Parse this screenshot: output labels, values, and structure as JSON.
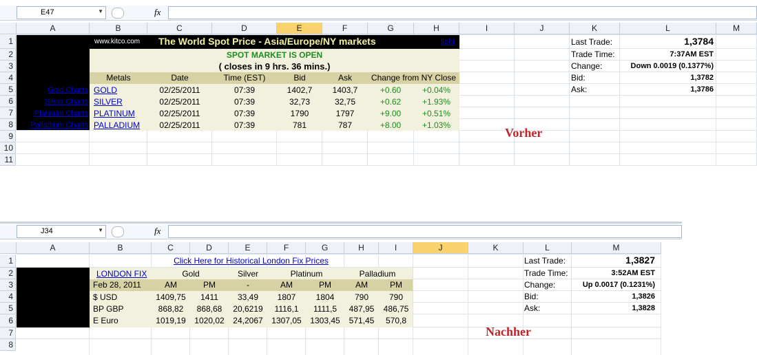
{
  "top": {
    "name_box": "E47",
    "fx_label": "fx",
    "columns": [
      "A",
      "B",
      "C",
      "D",
      "E",
      "F",
      "G",
      "H",
      "I",
      "J",
      "K",
      "L",
      "M"
    ],
    "rows": [
      "1",
      "2",
      "3",
      "4",
      "5",
      "6",
      "7",
      "8",
      "9",
      "10",
      "11"
    ],
    "kitco": "www.kitco.com",
    "title": "The World Spot Price - Asia/Europe/NY markets",
    "light": "light",
    "market_status": "SPOT MARKET IS OPEN",
    "closes_in": "( closes in 9 hrs. 36 mins.)",
    "headers": [
      "Metals",
      "Date",
      "Time (EST)",
      "Bid",
      "Ask",
      "Change from NY Close"
    ],
    "chart_links": [
      "Gold Charts",
      "Silver Charts",
      "Platinum Charts",
      "Palladium Charts"
    ],
    "metals": [
      {
        "name": "GOLD",
        "date": "02/25/2011",
        "time": "07:39",
        "bid": "1402,7",
        "ask": "1403,7",
        "chg": "+0.60",
        "pct": "+0.04%"
      },
      {
        "name": "SILVER",
        "date": "02/25/2011",
        "time": "07:39",
        "bid": "32,73",
        "ask": "32,75",
        "chg": "+0.62",
        "pct": "+1.93%"
      },
      {
        "name": "PLATINUM",
        "date": "02/25/2011",
        "time": "07:39",
        "bid": "1790",
        "ask": "1797",
        "chg": "+9.00",
        "pct": "+0.51%"
      },
      {
        "name": "PALLADIUM",
        "date": "02/25/2011",
        "time": "07:39",
        "bid": "781",
        "ask": "787",
        "chg": "+8.00",
        "pct": "+1.03%"
      }
    ],
    "fx": {
      "last_trade_label": "Last Trade:",
      "last_trade": "1,3784",
      "trade_time_label": "Trade Time:",
      "trade_time": "7:37AM EST",
      "change_label": "Change:",
      "change": "Down 0.0019 (0.1377%)",
      "bid_label": "Bid:",
      "bid": "1,3782",
      "ask_label": "Ask:",
      "ask": "1,3786"
    },
    "label": "Vorher"
  },
  "bottom": {
    "name_box": "J34",
    "fx_label": "fx",
    "columns": [
      "A",
      "B",
      "C",
      "D",
      "E",
      "F",
      "G",
      "H",
      "I",
      "J",
      "K",
      "L",
      "M"
    ],
    "rows": [
      "1",
      "2",
      "3",
      "4",
      "5",
      "6",
      "7",
      "8"
    ],
    "hist_link": "Click Here for Historical London Fix Prices",
    "london_fix": "LONDON FIX",
    "metals": [
      "Gold",
      "Silver",
      "Platinum",
      "Palladium"
    ],
    "date": "Feb 28, 2011",
    "subheaders": [
      "AM",
      "PM",
      "-",
      "AM",
      "PM",
      "AM",
      "PM"
    ],
    "rows_data": [
      {
        "cur": "$ USD",
        "vals": [
          "1409,75",
          "1411",
          "33,49",
          "1807",
          "1804",
          "790",
          "790"
        ]
      },
      {
        "cur": "BP GBP",
        "vals": [
          "868,82",
          "868,68",
          "20,6219",
          "1116,1",
          "1111,5",
          "487,95",
          "486,75"
        ]
      },
      {
        "cur": "E Euro",
        "vals": [
          "1019,19",
          "1020,02",
          "24,2067",
          "1307,05",
          "1303,45",
          "571,45",
          "570,8"
        ]
      }
    ],
    "fx": {
      "last_trade_label": "Last Trade:",
      "last_trade": "1,3827",
      "trade_time_label": "Trade Time:",
      "trade_time": "3:52AM EST",
      "change_label": "Change:",
      "change": "Up 0.0017 (0.1231%)",
      "bid_label": "Bid:",
      "bid": "1,3826",
      "ask_label": "Ask:",
      "ask": "1,3828"
    },
    "label": "Nachher"
  }
}
